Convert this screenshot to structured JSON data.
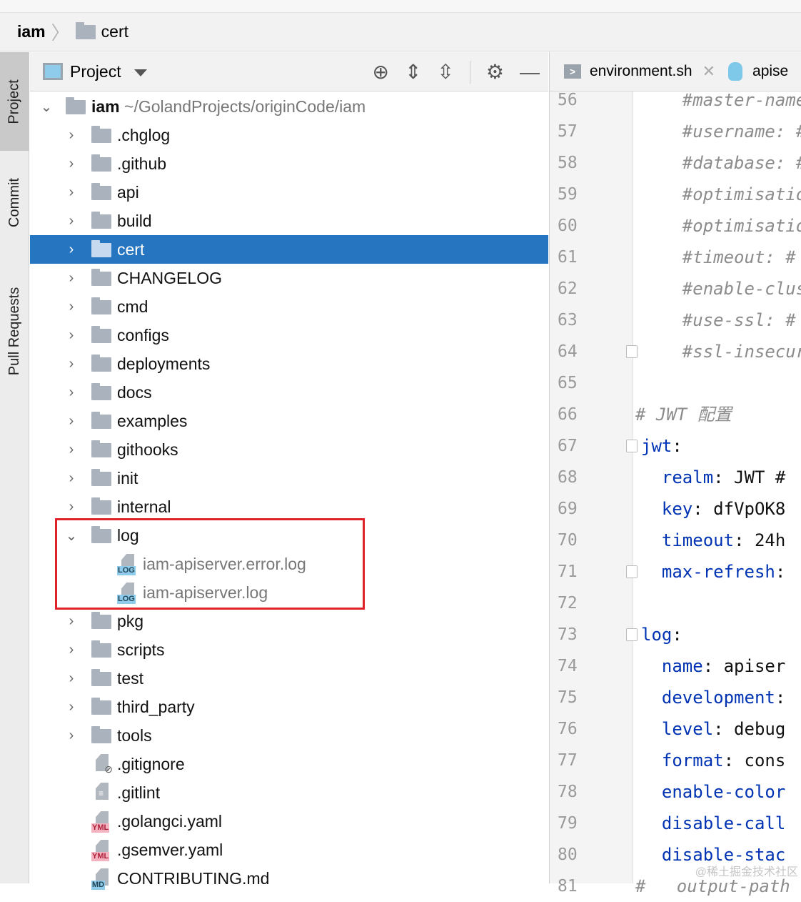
{
  "breadcrumb": {
    "root": "iam",
    "current": "cert"
  },
  "toolwindow_tabs": [
    {
      "label": "Project",
      "selected": true
    },
    {
      "label": "Commit"
    },
    {
      "label": "Pull Requests"
    }
  ],
  "panel": {
    "title": "Project"
  },
  "tree": {
    "root": {
      "name": "iam",
      "path": "~/GolandProjects/originCode/iam"
    },
    "items": [
      {
        "name": ".chglog",
        "type": "folder"
      },
      {
        "name": ".github",
        "type": "folder"
      },
      {
        "name": "api",
        "type": "folder"
      },
      {
        "name": "build",
        "type": "folder"
      },
      {
        "name": "cert",
        "type": "folder",
        "selected": true
      },
      {
        "name": "CHANGELOG",
        "type": "folder"
      },
      {
        "name": "cmd",
        "type": "folder"
      },
      {
        "name": "configs",
        "type": "folder"
      },
      {
        "name": "deployments",
        "type": "folder"
      },
      {
        "name": "docs",
        "type": "folder"
      },
      {
        "name": "examples",
        "type": "folder"
      },
      {
        "name": "githooks",
        "type": "folder"
      },
      {
        "name": "init",
        "type": "folder"
      },
      {
        "name": "internal",
        "type": "folder"
      },
      {
        "name": "log",
        "type": "folder",
        "expanded": true
      },
      {
        "name": "iam-apiserver.error.log",
        "type": "log",
        "child": true
      },
      {
        "name": "iam-apiserver.log",
        "type": "log",
        "child": true
      },
      {
        "name": "pkg",
        "type": "folder"
      },
      {
        "name": "scripts",
        "type": "folder"
      },
      {
        "name": "test",
        "type": "folder"
      },
      {
        "name": "third_party",
        "type": "folder"
      },
      {
        "name": "tools",
        "type": "folder"
      },
      {
        "name": ".gitignore",
        "type": "ignore"
      },
      {
        "name": ".gitlint",
        "type": "text"
      },
      {
        "name": ".golangci.yaml",
        "type": "yml",
        "tag": "YML"
      },
      {
        "name": ".gsemver.yaml",
        "type": "yml",
        "tag": "YML"
      },
      {
        "name": "CONTRIBUTING.md",
        "type": "md",
        "tag": "MD"
      }
    ],
    "log_tag": "LOG"
  },
  "editor": {
    "tabs": [
      {
        "label": "environment.sh",
        "icon": ">"
      },
      {
        "label": "apise"
      }
    ],
    "lines": [
      {
        "n": "56",
        "ind": "    ",
        "key": "",
        "rest": "#master-name",
        "c": true
      },
      {
        "n": "57",
        "ind": "    ",
        "key": "",
        "rest": "#username: #",
        "c": true
      },
      {
        "n": "58",
        "ind": "    ",
        "key": "",
        "rest": "#database: #",
        "c": true
      },
      {
        "n": "59",
        "ind": "    ",
        "key": "",
        "rest": "#optimisatio",
        "c": true
      },
      {
        "n": "60",
        "ind": "    ",
        "key": "",
        "rest": "#optimisatio",
        "c": true
      },
      {
        "n": "61",
        "ind": "    ",
        "key": "",
        "rest": "#timeout: #",
        "c": true
      },
      {
        "n": "62",
        "ind": "    ",
        "key": "",
        "rest": "#enable-clus",
        "c": true
      },
      {
        "n": "63",
        "ind": "    ",
        "key": "",
        "rest": "#use-ssl: #",
        "c": true
      },
      {
        "n": "64",
        "ind": "    ",
        "key": "",
        "rest": "#ssl-insecur",
        "c": true
      },
      {
        "n": "65",
        "ind": "",
        "key": "",
        "rest": ""
      },
      {
        "n": "66",
        "ind": "",
        "key": "",
        "rest": "# JWT 配置",
        "c": true
      },
      {
        "n": "67",
        "ind": "",
        "key": "jwt",
        "rest": ":"
      },
      {
        "n": "68",
        "ind": "  ",
        "key": "realm",
        "rest": ": JWT #"
      },
      {
        "n": "69",
        "ind": "  ",
        "key": "key",
        "rest": ": dfVpOK8"
      },
      {
        "n": "70",
        "ind": "  ",
        "key": "timeout",
        "rest": ": 24h"
      },
      {
        "n": "71",
        "ind": "  ",
        "key": "max-refresh",
        "rest": ":"
      },
      {
        "n": "72",
        "ind": "",
        "key": "",
        "rest": ""
      },
      {
        "n": "73",
        "ind": "",
        "key": "log",
        "rest": ":"
      },
      {
        "n": "74",
        "ind": "  ",
        "key": "name",
        "rest": ": apiser"
      },
      {
        "n": "75",
        "ind": "  ",
        "key": "development",
        "rest": ":"
      },
      {
        "n": "76",
        "ind": "  ",
        "key": "level",
        "rest": ": debug"
      },
      {
        "n": "77",
        "ind": "  ",
        "key": "format",
        "rest": ": cons"
      },
      {
        "n": "78",
        "ind": "  ",
        "key": "enable-color",
        "rest": ""
      },
      {
        "n": "79",
        "ind": "  ",
        "key": "disable-call",
        "rest": ""
      },
      {
        "n": "80",
        "ind": "  ",
        "key": "disable-stac",
        "rest": ""
      },
      {
        "n": "81",
        "ind": "",
        "key": "",
        "rest": "#   output-path",
        "c": true
      }
    ],
    "watermark": "@稀土掘金技术社区"
  },
  "colors": {
    "selection": "#2675c0",
    "highlight_box": "#e0222a",
    "yaml_key": "#0033b3"
  }
}
